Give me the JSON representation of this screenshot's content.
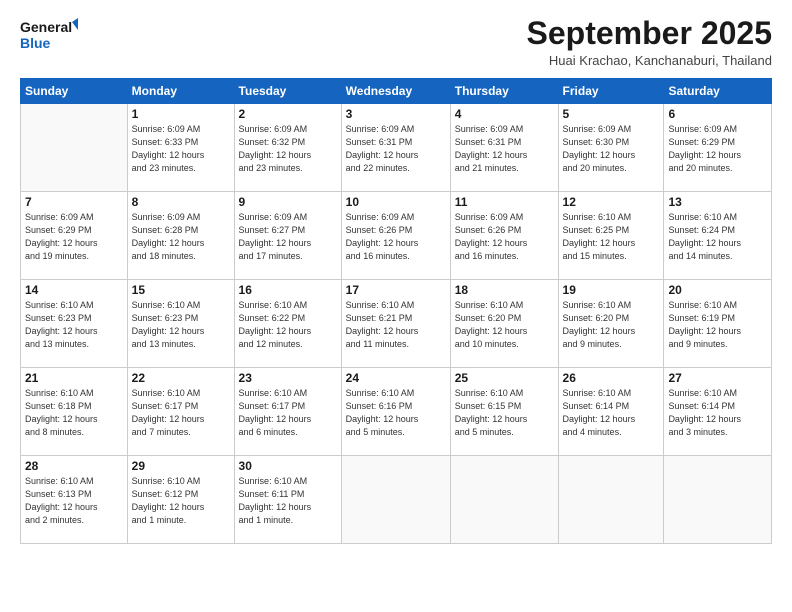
{
  "header": {
    "logo_line1": "General",
    "logo_line2": "Blue",
    "month_title": "September 2025",
    "location": "Huai Krachao, Kanchanaburi, Thailand"
  },
  "weekdays": [
    "Sunday",
    "Monday",
    "Tuesday",
    "Wednesday",
    "Thursday",
    "Friday",
    "Saturday"
  ],
  "weeks": [
    [
      {
        "day": "",
        "info": ""
      },
      {
        "day": "1",
        "info": "Sunrise: 6:09 AM\nSunset: 6:33 PM\nDaylight: 12 hours\nand 23 minutes."
      },
      {
        "day": "2",
        "info": "Sunrise: 6:09 AM\nSunset: 6:32 PM\nDaylight: 12 hours\nand 23 minutes."
      },
      {
        "day": "3",
        "info": "Sunrise: 6:09 AM\nSunset: 6:31 PM\nDaylight: 12 hours\nand 22 minutes."
      },
      {
        "day": "4",
        "info": "Sunrise: 6:09 AM\nSunset: 6:31 PM\nDaylight: 12 hours\nand 21 minutes."
      },
      {
        "day": "5",
        "info": "Sunrise: 6:09 AM\nSunset: 6:30 PM\nDaylight: 12 hours\nand 20 minutes."
      },
      {
        "day": "6",
        "info": "Sunrise: 6:09 AM\nSunset: 6:29 PM\nDaylight: 12 hours\nand 20 minutes."
      }
    ],
    [
      {
        "day": "7",
        "info": "Sunrise: 6:09 AM\nSunset: 6:29 PM\nDaylight: 12 hours\nand 19 minutes."
      },
      {
        "day": "8",
        "info": "Sunrise: 6:09 AM\nSunset: 6:28 PM\nDaylight: 12 hours\nand 18 minutes."
      },
      {
        "day": "9",
        "info": "Sunrise: 6:09 AM\nSunset: 6:27 PM\nDaylight: 12 hours\nand 17 minutes."
      },
      {
        "day": "10",
        "info": "Sunrise: 6:09 AM\nSunset: 6:26 PM\nDaylight: 12 hours\nand 16 minutes."
      },
      {
        "day": "11",
        "info": "Sunrise: 6:09 AM\nSunset: 6:26 PM\nDaylight: 12 hours\nand 16 minutes."
      },
      {
        "day": "12",
        "info": "Sunrise: 6:10 AM\nSunset: 6:25 PM\nDaylight: 12 hours\nand 15 minutes."
      },
      {
        "day": "13",
        "info": "Sunrise: 6:10 AM\nSunset: 6:24 PM\nDaylight: 12 hours\nand 14 minutes."
      }
    ],
    [
      {
        "day": "14",
        "info": "Sunrise: 6:10 AM\nSunset: 6:23 PM\nDaylight: 12 hours\nand 13 minutes."
      },
      {
        "day": "15",
        "info": "Sunrise: 6:10 AM\nSunset: 6:23 PM\nDaylight: 12 hours\nand 13 minutes."
      },
      {
        "day": "16",
        "info": "Sunrise: 6:10 AM\nSunset: 6:22 PM\nDaylight: 12 hours\nand 12 minutes."
      },
      {
        "day": "17",
        "info": "Sunrise: 6:10 AM\nSunset: 6:21 PM\nDaylight: 12 hours\nand 11 minutes."
      },
      {
        "day": "18",
        "info": "Sunrise: 6:10 AM\nSunset: 6:20 PM\nDaylight: 12 hours\nand 10 minutes."
      },
      {
        "day": "19",
        "info": "Sunrise: 6:10 AM\nSunset: 6:20 PM\nDaylight: 12 hours\nand 9 minutes."
      },
      {
        "day": "20",
        "info": "Sunrise: 6:10 AM\nSunset: 6:19 PM\nDaylight: 12 hours\nand 9 minutes."
      }
    ],
    [
      {
        "day": "21",
        "info": "Sunrise: 6:10 AM\nSunset: 6:18 PM\nDaylight: 12 hours\nand 8 minutes."
      },
      {
        "day": "22",
        "info": "Sunrise: 6:10 AM\nSunset: 6:17 PM\nDaylight: 12 hours\nand 7 minutes."
      },
      {
        "day": "23",
        "info": "Sunrise: 6:10 AM\nSunset: 6:17 PM\nDaylight: 12 hours\nand 6 minutes."
      },
      {
        "day": "24",
        "info": "Sunrise: 6:10 AM\nSunset: 6:16 PM\nDaylight: 12 hours\nand 5 minutes."
      },
      {
        "day": "25",
        "info": "Sunrise: 6:10 AM\nSunset: 6:15 PM\nDaylight: 12 hours\nand 5 minutes."
      },
      {
        "day": "26",
        "info": "Sunrise: 6:10 AM\nSunset: 6:14 PM\nDaylight: 12 hours\nand 4 minutes."
      },
      {
        "day": "27",
        "info": "Sunrise: 6:10 AM\nSunset: 6:14 PM\nDaylight: 12 hours\nand 3 minutes."
      }
    ],
    [
      {
        "day": "28",
        "info": "Sunrise: 6:10 AM\nSunset: 6:13 PM\nDaylight: 12 hours\nand 2 minutes."
      },
      {
        "day": "29",
        "info": "Sunrise: 6:10 AM\nSunset: 6:12 PM\nDaylight: 12 hours\nand 1 minute."
      },
      {
        "day": "30",
        "info": "Sunrise: 6:10 AM\nSunset: 6:11 PM\nDaylight: 12 hours\nand 1 minute."
      },
      {
        "day": "",
        "info": ""
      },
      {
        "day": "",
        "info": ""
      },
      {
        "day": "",
        "info": ""
      },
      {
        "day": "",
        "info": ""
      }
    ]
  ]
}
